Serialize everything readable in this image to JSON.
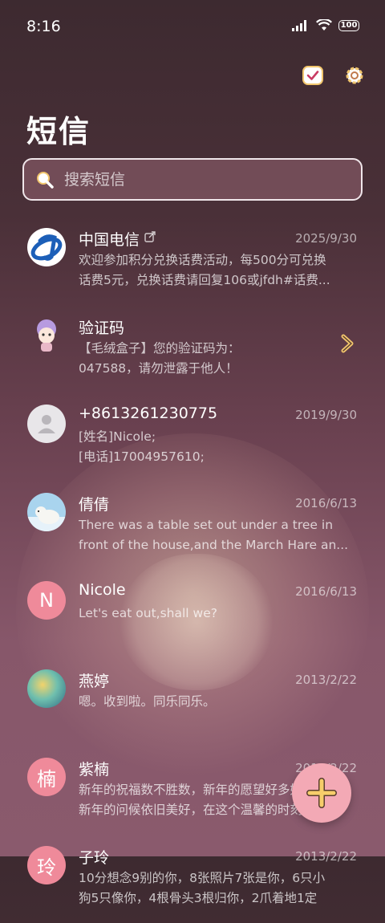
{
  "status_bar": {
    "time": "8:16",
    "battery": "100"
  },
  "header": {
    "title": "短信"
  },
  "search": {
    "placeholder": "搜索短信"
  },
  "conversations": [
    {
      "name": "中国电信",
      "date": "2025/9/30",
      "line1": "欢迎参加积分兑换话费活动，每500分可兑换",
      "line2": "话费5元，兑换话费请回复106或jfdh#话费..."
    },
    {
      "name": "验证码",
      "date": "",
      "line1": "【毛绒盒子】您的验证码为：",
      "line2": "047588，请勿泄露于他人！"
    },
    {
      "name": "+8613261230775",
      "date": "2019/9/30",
      "line1": "[姓名]Nicole;",
      "line2": "[电话]17004957610;"
    },
    {
      "name": "倩倩",
      "date": "2016/6/13",
      "line1": "There was a table set out under a tree in",
      "line2": "front of the house,and the March Hare an..."
    },
    {
      "name": "Nicole",
      "date": "2016/6/13",
      "avatar_letter": "N",
      "line1": "Let's eat out,shall we?",
      "line2": ""
    },
    {
      "name": "燕婷",
      "date": "2013/2/22",
      "line1": "嗯。收到啦。同乐同乐。",
      "line2": ""
    },
    {
      "name": "紫楠",
      "date": "2013/2/22",
      "avatar_letter": "楠",
      "line1": "新年的祝福数不胜数，新年的愿望好多好多，",
      "line2": "新年的问候依旧美好，在这个温馨的时刻，..."
    },
    {
      "name": "子玲",
      "date": "2013/2/22",
      "avatar_letter": "玲",
      "line1": "10分想念9别的你，8张照片7张是你，6只小",
      "line2": "狗5只像你，4根骨头3根归你，2爪着地1定"
    }
  ],
  "colors": {
    "accent": "#ef8a9a",
    "fab": "#f3a9b5",
    "background_top": "#3d2a30",
    "background_bottom": "#8a5a6d"
  }
}
